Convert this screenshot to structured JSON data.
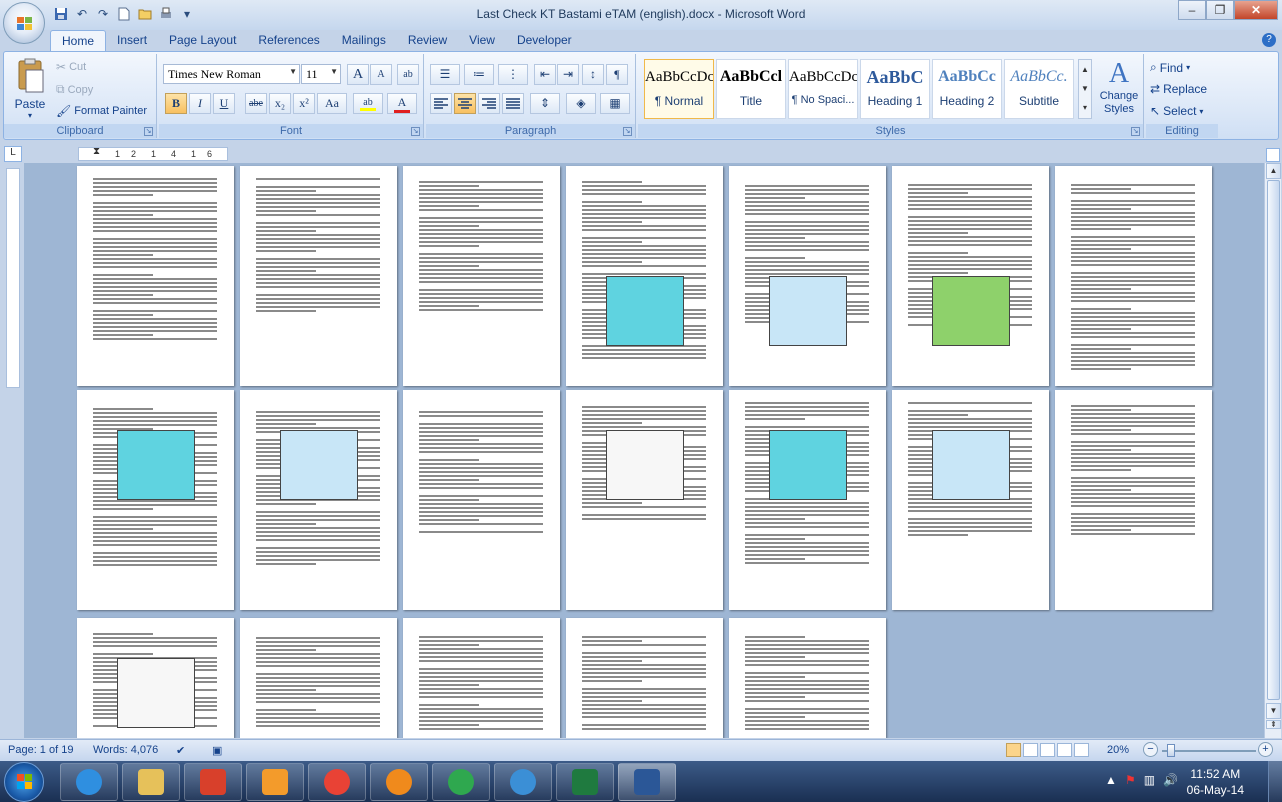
{
  "title_bar": {
    "title": "Last Check KT Bastami eTAM (english).docx - Microsoft Word",
    "quick_access": [
      "save-icon",
      "undo-icon",
      "redo-icon",
      "new-document-icon",
      "open-icon",
      "print-preview-icon",
      "customize-icon"
    ],
    "controls": {
      "minimize": "–",
      "restore": "❐",
      "close": "✕"
    }
  },
  "tabs": [
    {
      "label": "Home",
      "active": true
    },
    {
      "label": "Insert"
    },
    {
      "label": "Page Layout"
    },
    {
      "label": "References"
    },
    {
      "label": "Mailings"
    },
    {
      "label": "Review"
    },
    {
      "label": "View"
    },
    {
      "label": "Developer"
    }
  ],
  "help": "?",
  "ribbon": {
    "clipboard": {
      "label": "Clipboard",
      "paste": "Paste",
      "cut": "Cut",
      "copy": "Copy",
      "format_painter": "Format Painter"
    },
    "font": {
      "label": "Font",
      "font_name": "Times New Roman",
      "font_size": "11",
      "grow": "A",
      "shrink": "A",
      "clear": "ab",
      "bold": "B",
      "italic": "I",
      "underline": "U",
      "strike": "abe",
      "subscript": "x₂",
      "superscript": "x²",
      "case": "Aa",
      "highlight": "ab",
      "font_color": "A",
      "highlight_color": "#ffff00",
      "font_color_value": "#e02020"
    },
    "paragraph": {
      "label": "Paragraph"
    },
    "styles": {
      "label": "Styles",
      "items": [
        {
          "sample": "AaBbCcDc",
          "name": "¶ Normal",
          "selected": true
        },
        {
          "sample": "AaBbCcl",
          "name": "Title"
        },
        {
          "sample": "AaBbCcDc",
          "name": "¶ No Spaci..."
        },
        {
          "sample": "AaBbC",
          "name": "Heading 1"
        },
        {
          "sample": "AaBbCc",
          "name": "Heading 2"
        },
        {
          "sample": "AaBbCc.",
          "name": "Subtitle"
        }
      ],
      "change_styles": "Change Styles"
    },
    "editing": {
      "label": "Editing",
      "find": "Find",
      "replace": "Replace",
      "select": "Select"
    }
  },
  "ruler": {
    "corner": "L",
    "ticks": [
      "1",
      "2",
      "1",
      "4",
      "1",
      "6"
    ]
  },
  "status_bar": {
    "page": "Page: 1 of 19",
    "words": "Words: 4,076",
    "zoom": "20%",
    "zoom_level": 0.2
  },
  "taskbar": {
    "apps": [
      "internet-explorer-icon",
      "file-explorer-icon",
      "adobe-reader-icon",
      "media-player-icon",
      "chrome-icon",
      "firefox-icon",
      "network-icon",
      "globe-icon",
      "excel-icon",
      "word-icon"
    ],
    "time": "11:52 AM",
    "date": "06-May-14"
  }
}
